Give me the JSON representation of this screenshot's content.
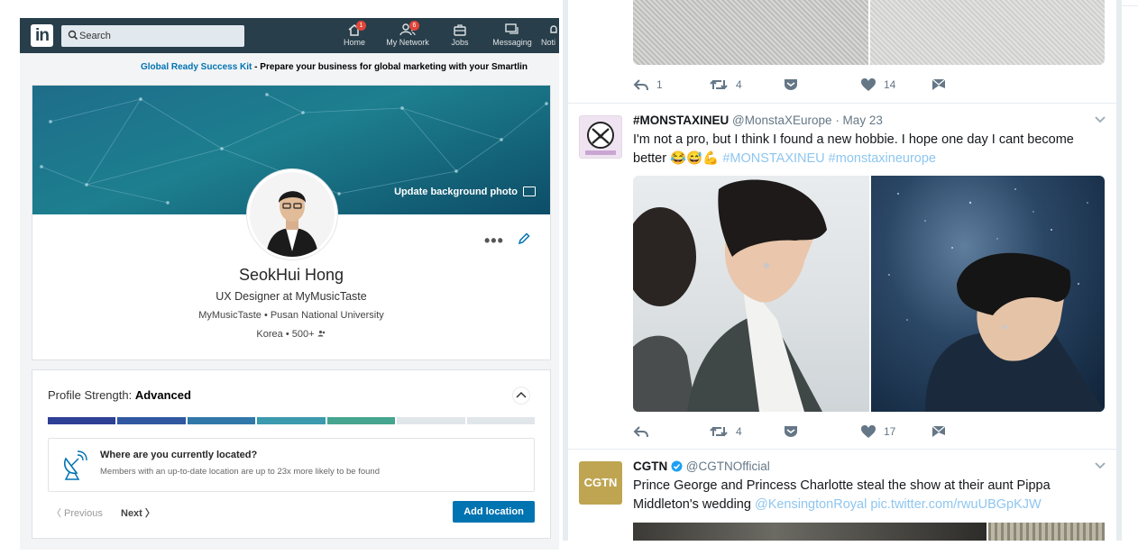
{
  "linkedin": {
    "logo": "in",
    "search": {
      "placeholder": "Search"
    },
    "nav": [
      {
        "label": "Home",
        "icon": "home-icon",
        "badge": "1"
      },
      {
        "label": "My Network",
        "icon": "network-icon",
        "badge": "6"
      },
      {
        "label": "Jobs",
        "icon": "briefcase-icon",
        "badge": ""
      },
      {
        "label": "Messaging",
        "icon": "messaging-icon",
        "badge": ""
      },
      {
        "label": "Noti",
        "icon": "notifications-icon",
        "badge": ""
      }
    ],
    "promo": {
      "link": "Global Ready Success Kit",
      "text": " - Prepare your business for global marketing with your Smartlin"
    },
    "profile": {
      "update_background": "Update background photo",
      "name": "SeokHui Hong",
      "headline": "UX Designer at MyMusicTaste",
      "education": "MyMusicTaste • Pusan National University",
      "location": "Korea • 500+",
      "more": "•••"
    },
    "strength": {
      "label": "Profile Strength: ",
      "level": "Advanced",
      "progress_segments_filled": 5,
      "progress_segments_total": 7,
      "segment_colors": [
        "#2e3f96",
        "#2f58a1",
        "#2f78a9",
        "#3b9aae",
        "#45a58f",
        "#e1e6ea",
        "#e1e6ea"
      ],
      "question": "Where are you currently located?",
      "question_sub": "Members with an up-to-date location are up to 23x more likely to be found",
      "previous": "〈  Previous",
      "next": "Next  〉",
      "add_location": "Add location"
    }
  },
  "twitter": {
    "top_actions": {
      "replies": "1",
      "retweets": "4",
      "likes": "14"
    },
    "tweets": [
      {
        "handle_name": "#MONSTAXINEU",
        "handle": "@MonstaXEurope",
        "date": "· May 23",
        "text": "I'm not a pro, but I think I found a new hobbie. I hope one day I cant become better ",
        "emoji": "😂😅💪",
        "hashtags": "#MONSTAXINEU #monstaxineurope",
        "retweets": "4",
        "likes": "17"
      },
      {
        "handle_name": "CGTN",
        "handle": "@CGTNOfficial",
        "avatar_text": "CGTN",
        "text": "Prince George and Princess Charlotte steal the show at their aunt Pippa Middleton's wedding ",
        "links": "@KensingtonRoyal pic.twitter.com/rwuUBGpKJW"
      }
    ]
  },
  "colors": {
    "linkedin_nav": "#283e4a",
    "linkedin_blue": "#0073b1",
    "twitter_link": "#8ec6f0",
    "twitter_gray": "#657786",
    "cgtn_gold": "#bfa552"
  }
}
